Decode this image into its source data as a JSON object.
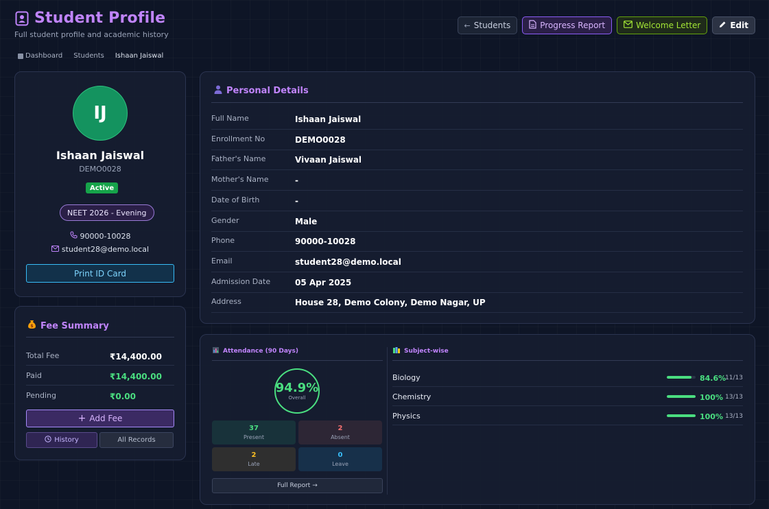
{
  "header": {
    "title": "Student Profile",
    "subtitle": "Full student profile and academic history",
    "actions": {
      "students": "Students",
      "progress": "Progress Report",
      "welcome": "Welcome Letter",
      "edit": "Edit"
    }
  },
  "breadcrumb": [
    "Dashboard",
    "Students",
    "Ishaan Jaiswal"
  ],
  "profile": {
    "initials": "IJ",
    "name": "Ishaan Jaiswal",
    "enrollment": "DEMO0028",
    "status": "Active",
    "batch": "NEET 2026 - Evening",
    "phone": "90000-10028",
    "email": "student28@demo.local",
    "print_label": "Print ID Card"
  },
  "fee": {
    "heading": "Fee Summary",
    "rows": [
      {
        "label": "Total Fee",
        "value": "₹14,400.00"
      },
      {
        "label": "Paid",
        "value": "₹14,400.00"
      },
      {
        "label": "Pending",
        "value": "₹0.00"
      }
    ],
    "add_label": "Add Fee",
    "history_label": "History",
    "all_records_label": "All Records"
  },
  "details": {
    "heading": "Personal Details",
    "rows": [
      {
        "label": "Full Name",
        "value": "Ishaan Jaiswal"
      },
      {
        "label": "Enrollment No",
        "value": "DEMO0028"
      },
      {
        "label": "Father's Name",
        "value": "Vivaan Jaiswal"
      },
      {
        "label": "Mother's Name",
        "value": "-"
      },
      {
        "label": "Date of Birth",
        "value": "-"
      },
      {
        "label": "Gender",
        "value": "Male"
      },
      {
        "label": "Phone",
        "value": "90000-10028"
      },
      {
        "label": "Email",
        "value": "student28@demo.local"
      },
      {
        "label": "Admission Date",
        "value": "05 Apr 2025"
      },
      {
        "label": "Address",
        "value": "House 28, Demo Colony, Demo Nagar, UP"
      }
    ]
  },
  "attendance": {
    "heading": "Attendance (90 Days)",
    "overall_pct": "94.9%",
    "overall_label": "Overall",
    "present": {
      "value": "37",
      "label": "Present"
    },
    "absent": {
      "value": "2",
      "label": "Absent"
    },
    "late": {
      "value": "2",
      "label": "Late"
    },
    "leave": {
      "value": "0",
      "label": "Leave"
    },
    "full_report_label": "Full Report →"
  },
  "subjects": {
    "heading": "Subject-wise",
    "rows": [
      {
        "name": "Biology",
        "pct": "84.6%",
        "fraction": 0.846,
        "count": "11/13"
      },
      {
        "name": "Chemistry",
        "pct": "100%",
        "fraction": 1.0,
        "count": "13/13"
      },
      {
        "name": "Physics",
        "pct": "100%",
        "fraction": 1.0,
        "count": "13/13"
      }
    ]
  },
  "colors": {
    "accent": "#c084fc",
    "success": "#4ade80",
    "avatar_bg": "#14935f",
    "absent": "#f87171",
    "late": "#fbbf24",
    "leave": "#38bdf8"
  }
}
